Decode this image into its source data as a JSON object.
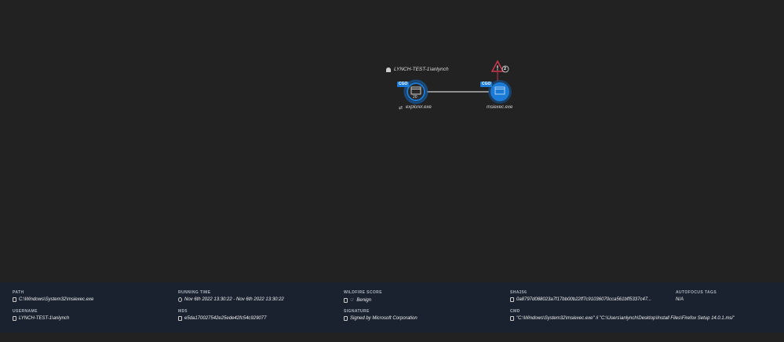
{
  "graph": {
    "user": "LYNCH-TEST-1\\anlynch",
    "nodes": [
      {
        "name": "explorer.exe",
        "tag": "CGO",
        "count": "20"
      },
      {
        "name": "msiexec.exe",
        "tag": "CGO",
        "alert_count": "2"
      }
    ]
  },
  "details": {
    "path": {
      "label": "PATH",
      "value": "C:\\Windows\\System32\\msiexec.exe"
    },
    "username": {
      "label": "USERNAME",
      "value": "LYNCH-TEST-1\\anlynch"
    },
    "running_time": {
      "label": "RUNNING TIME",
      "value": "Nov 6th 2022 13:30:22 - Nov 6th 2022 13:30:22"
    },
    "md5": {
      "label": "MD5",
      "value": "e5da170027542e25ede42fc54c929077"
    },
    "wildfire": {
      "label": "WILDFIRE SCORE",
      "value": "Benign"
    },
    "signature": {
      "label": "SIGNATURE",
      "value": "Signed by Microsoft Corporation"
    },
    "sha256": {
      "label": "SHA256",
      "value": "0a8797d088023a7f17bb00b22ff7c91036070cca561bff5337c47..."
    },
    "cmd": {
      "label": "CMD",
      "value": "\"C:\\Windows\\System32\\msiexec.exe\" /i \"C:\\Users\\anlynch\\Desktop\\Install Files\\Firefox Setup 14.0.1.msi\""
    },
    "autofocus": {
      "label": "AUTOFOCUS TAGS",
      "value": "N/A"
    }
  }
}
